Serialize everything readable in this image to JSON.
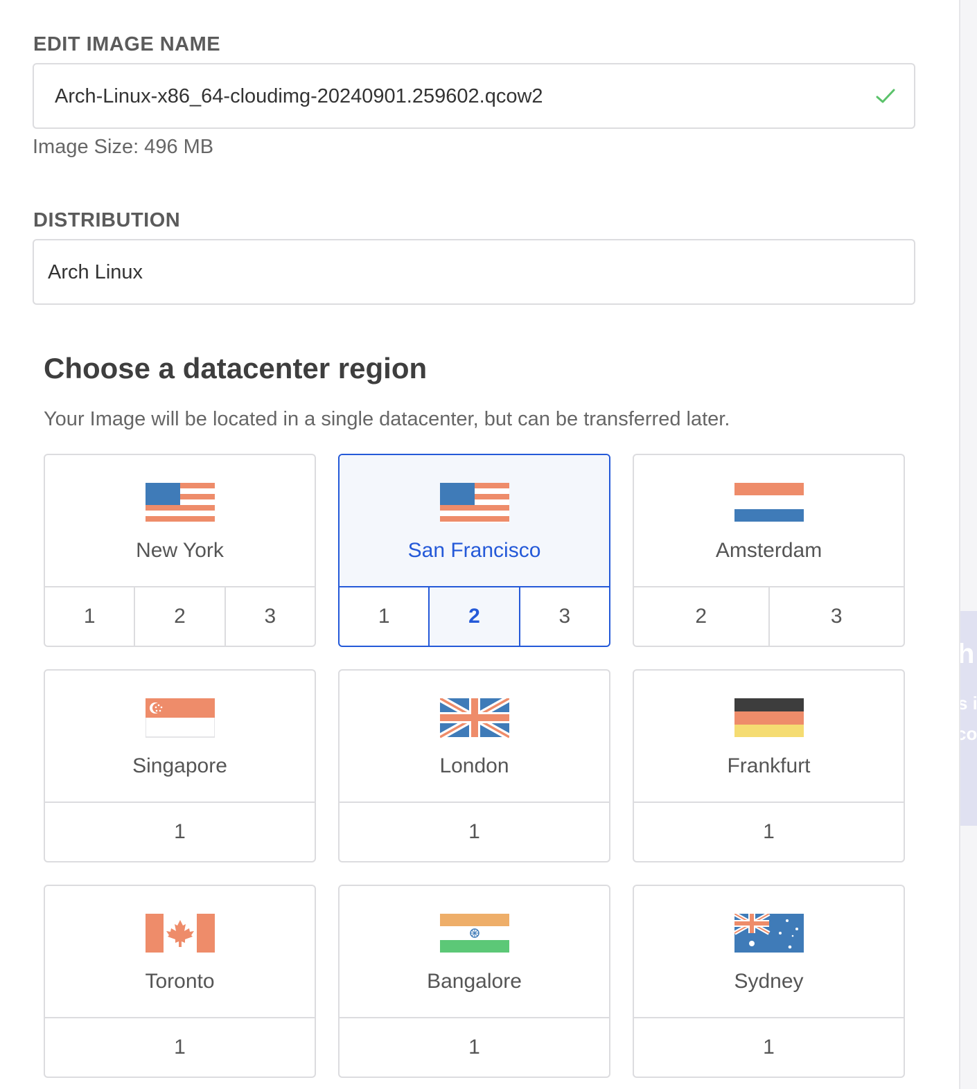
{
  "image_name": {
    "label": "EDIT IMAGE NAME",
    "value": "Arch-Linux-x86_64-cloudimg-20240901.259602.qcow2",
    "valid_icon": "check-icon",
    "size_hint": "Image Size: 496 MB"
  },
  "distribution": {
    "label": "DISTRIBUTION",
    "value": "Arch Linux"
  },
  "region_section": {
    "title": "Choose a datacenter region",
    "subtitle": "Your Image will be located in a single datacenter, but can be transferred later."
  },
  "colors": {
    "accent": "#2459d8",
    "valid": "#5ac26a",
    "border": "#dcdcdf",
    "flag_blue": "#3f7bb8",
    "flag_salmon": "#ee8c6a",
    "flag_gold": "#f5dc72",
    "flag_dark": "#3d3d3d",
    "flag_green": "#5cc877",
    "flag_saffron": "#eeae69"
  },
  "regions": [
    {
      "name": "New York",
      "flag": "usa-flag-icon",
      "datacenters": [
        "1",
        "2",
        "3"
      ]
    },
    {
      "name": "San Francisco",
      "flag": "usa-flag-icon",
      "datacenters": [
        "1",
        "2",
        "3"
      ],
      "selected": true,
      "selected_datacenter": "2"
    },
    {
      "name": "Amsterdam",
      "flag": "netherlands-flag-icon",
      "datacenters": [
        "2",
        "3"
      ]
    },
    {
      "name": "Singapore",
      "flag": "singapore-flag-icon",
      "datacenters": [
        "1"
      ]
    },
    {
      "name": "London",
      "flag": "uk-flag-icon",
      "datacenters": [
        "1"
      ]
    },
    {
      "name": "Frankfurt",
      "flag": "germany-flag-icon",
      "datacenters": [
        "1"
      ]
    },
    {
      "name": "Toronto",
      "flag": "canada-flag-icon",
      "datacenters": [
        "1"
      ]
    },
    {
      "name": "Bangalore",
      "flag": "india-flag-icon",
      "datacenters": [
        "1"
      ]
    },
    {
      "name": "Sydney",
      "flag": "australia-flag-icon",
      "datacenters": [
        "1"
      ]
    }
  ]
}
